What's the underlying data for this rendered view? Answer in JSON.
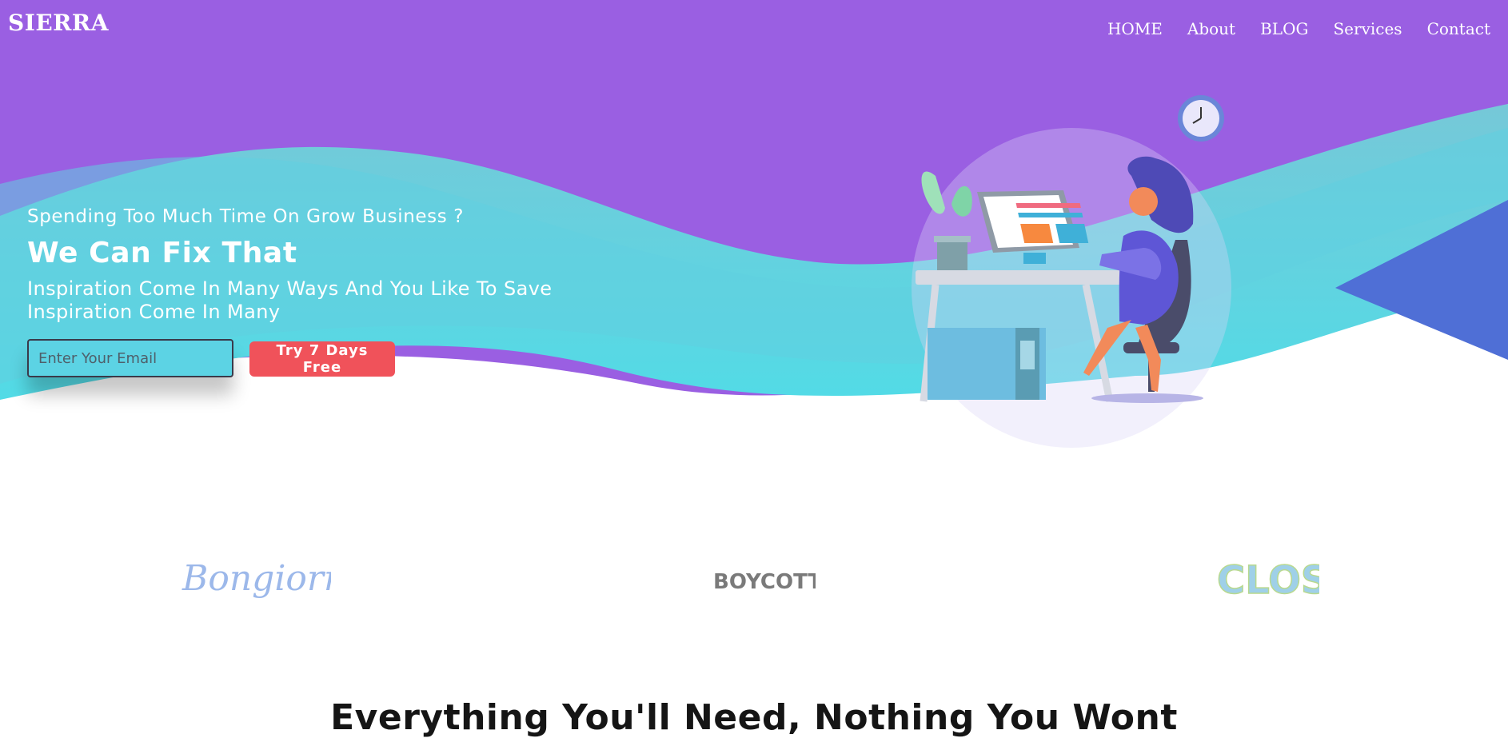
{
  "brand": {
    "name": "SIERRA"
  },
  "nav": {
    "items": [
      "HOME",
      "About",
      "BLOG",
      "Services",
      "Contact"
    ]
  },
  "hero": {
    "subtitle": "Spending Too Much Time On Grow Business ?",
    "title": "We Can Fix That",
    "description_line1": "Inspiration Come In Many Ways And You Like To Save",
    "description_line2": "Inspiration Come In Many",
    "email_placeholder": "Enter Your Email",
    "cta_label": "Try 7 Days Free"
  },
  "logos": [
    "Bongiorno",
    "BOYCOTT",
    "CLOSE"
  ],
  "section": {
    "title": "Everything You'll Need, Nothing You Wont"
  },
  "colors": {
    "hero_purple": "#9a5fe2",
    "hero_teal": "#5bd6e4",
    "cta_red": "#f0525a",
    "wave_blue": "#4f6fd6"
  }
}
